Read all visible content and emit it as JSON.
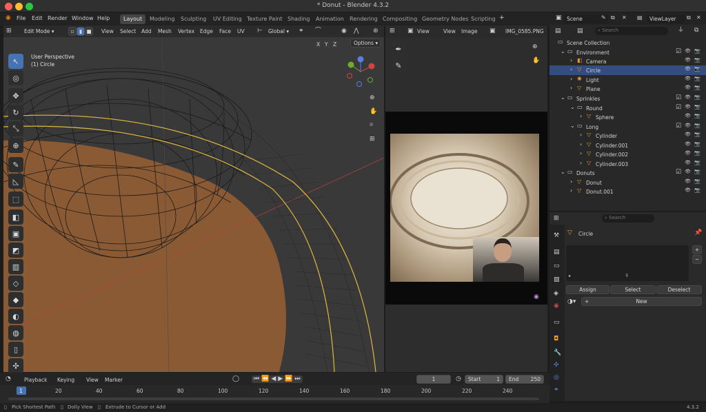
{
  "window": {
    "title": "* Donut - Blender 4.3.2"
  },
  "menu": {
    "file": "File",
    "edit": "Edit",
    "render": "Render",
    "window": "Window",
    "help": "Help"
  },
  "workspaces": [
    "Layout",
    "Modeling",
    "Sculpting",
    "UV Editing",
    "Texture Paint",
    "Shading",
    "Animation",
    "Rendering",
    "Compositing",
    "Geometry Nodes",
    "Scripting"
  ],
  "scene": {
    "name": "Scene",
    "view_layer": "ViewLayer"
  },
  "viewport": {
    "mode": "Edit Mode",
    "menus": [
      "View",
      "Select",
      "Add",
      "Mesh",
      "Vertex",
      "Edge",
      "Face",
      "UV"
    ],
    "orientation": "Global",
    "perspective": "User Perspective",
    "object": "(1) Circle",
    "options": "Options",
    "axes": [
      "X",
      "Y",
      "Z"
    ]
  },
  "image_editor": {
    "view1": "View",
    "view2": "View",
    "image": "Image",
    "filename": "IMG_0585.PNG"
  },
  "outliner": {
    "search_placeholder": "Search",
    "rows": [
      {
        "label": "Scene Collection",
        "indent": 0
      },
      {
        "label": "Environment",
        "indent": 1
      },
      {
        "label": "Camera",
        "indent": 2
      },
      {
        "label": "Circle",
        "indent": 2
      },
      {
        "label": "Light",
        "indent": 2
      },
      {
        "label": "Plane",
        "indent": 2
      },
      {
        "label": "Sprinkles",
        "indent": 1
      },
      {
        "label": "Round",
        "indent": 2
      },
      {
        "label": "Sphere",
        "indent": 3
      },
      {
        "label": "Long",
        "indent": 2
      },
      {
        "label": "Cylinder",
        "indent": 3
      },
      {
        "label": "Cylinder.001",
        "indent": 3
      },
      {
        "label": "Cylinder.002",
        "indent": 3
      },
      {
        "label": "Cylinder.003",
        "indent": 3
      },
      {
        "label": "Donuts",
        "indent": 1
      },
      {
        "label": "Donut",
        "indent": 2
      },
      {
        "label": "Donut.001",
        "indent": 2
      }
    ],
    "selected": "Circle"
  },
  "properties": {
    "search_placeholder": "Search",
    "object": "Circle",
    "assign": "Assign",
    "select": "Select",
    "deselect": "Deselect",
    "new": "New"
  },
  "timeline": {
    "playback": "Playback",
    "keying": "Keying",
    "view": "View",
    "marker": "Marker",
    "current_frame": "1",
    "start_label": "Start",
    "start": "1",
    "end_label": "End",
    "end": "250",
    "ticks": [
      "1",
      "20",
      "40",
      "60",
      "80",
      "100",
      "120",
      "140",
      "160",
      "180",
      "200",
      "220",
      "240"
    ]
  },
  "statusbar": {
    "hint1": "Pick Shortest Path",
    "hint2": "Dolly View",
    "hint3": "Extrude to Cursor or Add",
    "version": "4.3.2"
  },
  "colors": {
    "accent": "#4772b3",
    "selected_row": "#334d80",
    "active_object": "#e79a3a",
    "mesh_face": "#8a5a34"
  }
}
